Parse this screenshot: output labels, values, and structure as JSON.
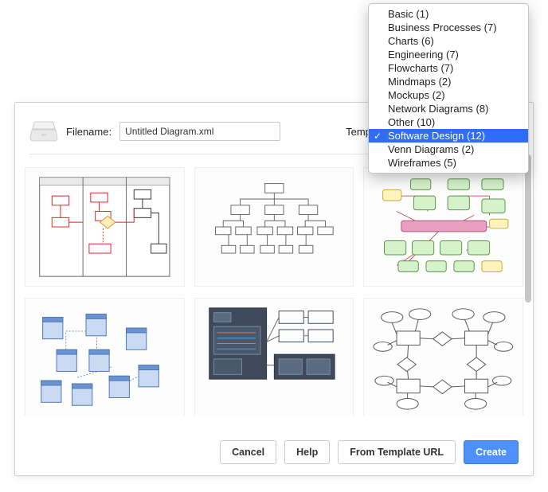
{
  "dialog": {
    "filename_label": "Filename:",
    "filename_value": "Untitled Diagram.xml",
    "templates_label": "Templates:",
    "buttons": {
      "cancel": "Cancel",
      "help": "Help",
      "from_url": "From Template URL",
      "create": "Create"
    }
  },
  "dropdown": {
    "items": [
      {
        "label": "Basic (1)"
      },
      {
        "label": "Business Processes (7)"
      },
      {
        "label": "Charts (6)"
      },
      {
        "label": "Engineering (7)"
      },
      {
        "label": "Flowcharts (7)"
      },
      {
        "label": "Mindmaps (2)"
      },
      {
        "label": "Mockups (2)"
      },
      {
        "label": "Network Diagrams (8)"
      },
      {
        "label": "Other (10)"
      },
      {
        "label": "Software Design (12)",
        "selected": true
      },
      {
        "label": "Venn Diagrams (2)"
      },
      {
        "label": "Wireframes (5)"
      }
    ]
  }
}
